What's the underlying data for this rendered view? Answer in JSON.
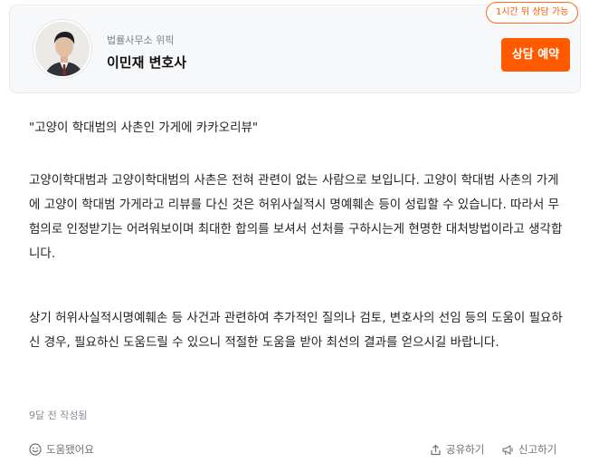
{
  "lawyer": {
    "firm": "법률사무소 위픽",
    "name": "이민재 변호사",
    "availability": "1시간 뒤 상담 가능",
    "consult_button": "상담 예약"
  },
  "answer": {
    "quote": "\"고양이 학대범의 사촌인 가게에 카카오리뷰\"",
    "body1": "고양이학대범과 고양이학대범의 사촌은 전혀 관련이 없는 사람으로 보입니다. 고양이 학대범 사촌의 가게에 고양이 학대범 가게라고 리뷰를 다신 것은 허위사실적시 명예훼손 등이 성립할 수 있습니다. 따라서 무험의로 인정받기는 어려워보이며 최대한 합의를 보셔서 선처를 구하시는게 현명한 대처방법이라고 생각합니다.",
    "body2": "상기 허위사실적시명예훼손 등 사건과 관련하여 추가적인 질의나 검토, 변호사의 선임 등의 도움이 필요하신 경우, 필요하신 도움드릴 수 있으니 적절한 도움을 받아 최선의 결과를 얻으시길 바랍니다.",
    "written_time": "9달 전 작성됨"
  },
  "actions": {
    "helpful": "도움됐어요",
    "share": "공유하기",
    "report": "신고하기"
  },
  "colors": {
    "accent": "#ff5a00",
    "card_bg": "#f7f8fa"
  },
  "icons": {
    "helpful": "smile-icon",
    "share": "share-icon",
    "report": "megaphone-icon"
  }
}
